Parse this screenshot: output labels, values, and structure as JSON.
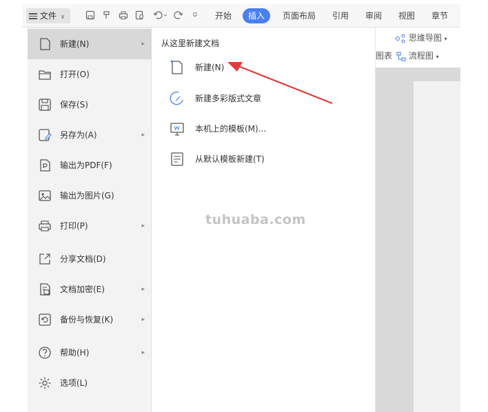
{
  "toolbar": {
    "file_label": "文件",
    "tabs": [
      {
        "label": "开始"
      },
      {
        "label": "插入",
        "active": true
      },
      {
        "label": "页面布局"
      },
      {
        "label": "引用"
      },
      {
        "label": "审阅"
      },
      {
        "label": "视图"
      },
      {
        "label": "章节"
      }
    ],
    "quick_icons": [
      "save-icon",
      "format-painter-icon",
      "print-icon",
      "print-preview-icon",
      "undo-icon",
      "redo-icon",
      "customize-icon"
    ]
  },
  "ribbon": {
    "mindmap_label": "思维导图",
    "flowchart_label": "流程图",
    "chart_label": "图表"
  },
  "file_menu": {
    "items": [
      {
        "label": "新建(N)",
        "icon": "new-doc-icon",
        "has_submenu": true,
        "selected": true
      },
      {
        "label": "打开(O)",
        "icon": "folder-icon",
        "has_submenu": false
      },
      {
        "label": "保存(S)",
        "icon": "save-icon",
        "has_submenu": false
      },
      {
        "label": "另存为(A)",
        "icon": "save-as-icon",
        "has_submenu": true
      },
      {
        "label": "输出为PDF(F)",
        "icon": "pdf-icon",
        "has_submenu": false
      },
      {
        "label": "输出为图片(G)",
        "icon": "image-icon",
        "has_submenu": false
      },
      {
        "label": "打印(P)",
        "icon": "print-icon",
        "has_submenu": true
      },
      {
        "label": "分享文档(D)",
        "icon": "share-icon",
        "has_submenu": false
      },
      {
        "label": "文档加密(E)",
        "icon": "encrypt-icon",
        "has_submenu": true
      },
      {
        "label": "备份与恢复(K)",
        "icon": "backup-icon",
        "has_submenu": true
      },
      {
        "label": "帮助(H)",
        "icon": "help-icon",
        "has_submenu": true
      },
      {
        "label": "选项(L)",
        "icon": "options-icon",
        "has_submenu": false
      }
    ]
  },
  "new_submenu": {
    "title": "从这里新建文档",
    "items": [
      {
        "label": "新建(N)",
        "icon": "new-blank-icon"
      },
      {
        "label": "新建多彩版式文章",
        "icon": "colorful-article-icon"
      },
      {
        "label": "本机上的模板(M)...",
        "icon": "local-template-icon"
      },
      {
        "label": "从默认模板新建(T)",
        "icon": "default-template-icon"
      }
    ]
  },
  "watermark": "tuhuaba.com",
  "colors": {
    "accent": "#4a7ff0",
    "annotation_arrow": "#e23b3b",
    "menu_bg": "#f3f3f3",
    "menu_selected": "#d8d8d8"
  }
}
